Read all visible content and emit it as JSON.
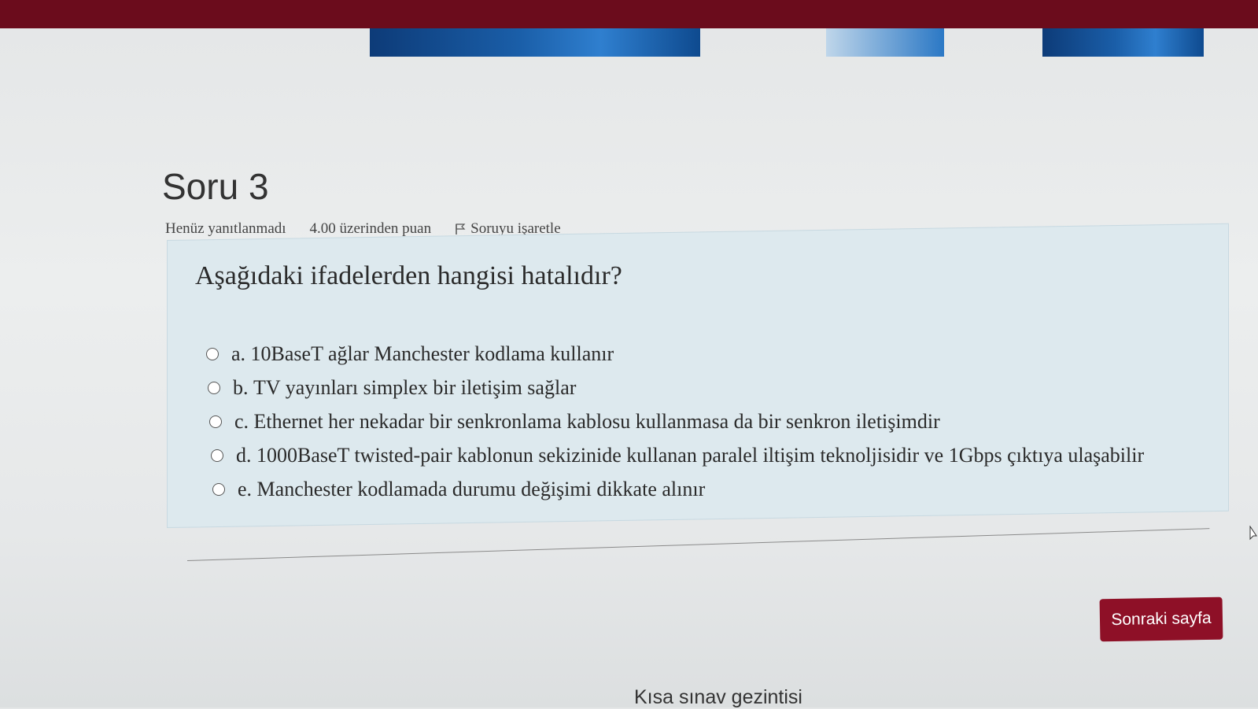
{
  "question": {
    "title": "Soru 3",
    "status": "Henüz yanıtlanmadı",
    "points": "4.00 üzerinden puan",
    "flag_label": "Soruyu işaretle",
    "text": "Aşağıdaki ifadelerden hangisi hatalıdır?",
    "answers": [
      {
        "letter": "a.",
        "text": "10BaseT ağlar Manchester kodlama kullanır"
      },
      {
        "letter": "b.",
        "text": "TV yayınları simplex bir iletişim sağlar"
      },
      {
        "letter": "c.",
        "text": "Ethernet her nekadar bir senkronlama kablosu kullanmasa da bir senkron iletişimdir"
      },
      {
        "letter": "d.",
        "text": "1000BaseT twisted-pair kablonun sekizinide kullanan paralel iltişim teknoljisidir ve 1Gbps çıktıya ulaşabilir"
      },
      {
        "letter": "e.",
        "text": "Manchester kodlamada durumu değişimi dikkate alınır"
      }
    ]
  },
  "navigation": {
    "next_button": "Sonraki sayfa",
    "quiz_nav_link": "Kısa sınav gezintisi"
  },
  "colors": {
    "top_bar": "#6b0c1c",
    "button": "#8e1027",
    "question_box": "#dde9ee"
  }
}
